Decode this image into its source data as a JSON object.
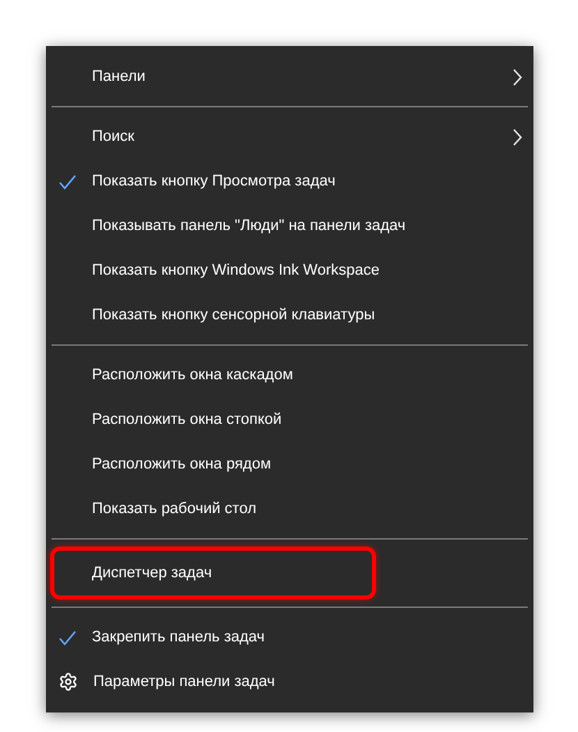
{
  "sections": [
    {
      "items": [
        {
          "label": "Панели",
          "kind": "submenu",
          "highlighted": false
        }
      ]
    },
    {
      "items": [
        {
          "label": "Поиск",
          "kind": "submenu",
          "highlighted": false
        },
        {
          "label": "Показать кнопку Просмотра задач",
          "kind": "check",
          "checked": true,
          "highlighted": false
        },
        {
          "label": "Показывать панель \"Люди\" на панели задач",
          "kind": "check",
          "checked": false,
          "highlighted": false
        },
        {
          "label": "Показать кнопку Windows Ink Workspace",
          "kind": "check",
          "checked": false,
          "highlighted": false
        },
        {
          "label": "Показать кнопку сенсорной клавиатуры",
          "kind": "check",
          "checked": false,
          "highlighted": false
        }
      ]
    },
    {
      "items": [
        {
          "label": "Расположить окна каскадом",
          "kind": "plain",
          "highlighted": false
        },
        {
          "label": "Расположить окна стопкой",
          "kind": "plain",
          "highlighted": false
        },
        {
          "label": "Расположить окна рядом",
          "kind": "plain",
          "highlighted": false
        },
        {
          "label": "Показать рабочий стол",
          "kind": "plain",
          "highlighted": false
        }
      ]
    },
    {
      "items": [
        {
          "label": "Диспетчер задач",
          "kind": "plain",
          "highlighted": true
        }
      ]
    },
    {
      "items": [
        {
          "label": "Закрепить панель задач",
          "kind": "check",
          "checked": true,
          "highlighted": false
        },
        {
          "label": "Параметры панели задач",
          "kind": "settings",
          "highlighted": false
        }
      ]
    }
  ]
}
